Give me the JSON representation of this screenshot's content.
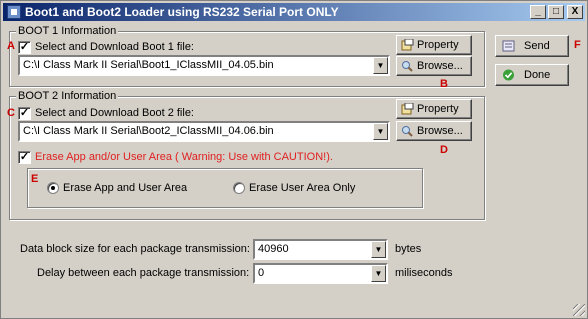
{
  "window": {
    "title": "Boot1 and Boot2 Loader using RS232 Serial Port ONLY",
    "minimize_label": "_",
    "maximize_label": "□",
    "close_label": "X"
  },
  "markers": {
    "a": "A",
    "b": "B",
    "c": "C",
    "d": "D",
    "e": "E",
    "f": "F"
  },
  "boot1": {
    "group_label": "BOOT 1 Information",
    "checkbox_label": "Select and Download Boot 1 file:",
    "checked": true,
    "file_path": "C:\\I Class Mark II Serial\\Boot1_IClassMII_04.05.bin",
    "property_label": "Property",
    "browse_label": "Browse..."
  },
  "boot2": {
    "group_label": "BOOT 2 Information",
    "checkbox_label": "Select and Download Boot 2 file:",
    "checked": true,
    "file_path": "C:\\I Class Mark II Serial\\Boot2_IClassMII_04.06.bin",
    "property_label": "Property",
    "browse_label": "Browse..."
  },
  "erase": {
    "checkbox_label": "Erase App and/or User Area ( Warning: Use with CAUTION!).",
    "checked": true,
    "option_app_user": "Erase App and User Area",
    "option_user_only": "Erase User Area Only",
    "selected": "Erase App and User Area"
  },
  "settings": {
    "block_size_label": "Data block size for each package transmission:",
    "block_size_value": "40960",
    "block_size_unit": "bytes",
    "delay_label": "Delay between each package transmission:",
    "delay_value": "0",
    "delay_unit": "miliseconds"
  },
  "actions": {
    "send_label": "Send",
    "done_label": "Done"
  },
  "colors": {
    "title_start": "#0a246a",
    "title_end": "#a6caf0",
    "warning": "#e02020",
    "marker": "#cc0000"
  }
}
